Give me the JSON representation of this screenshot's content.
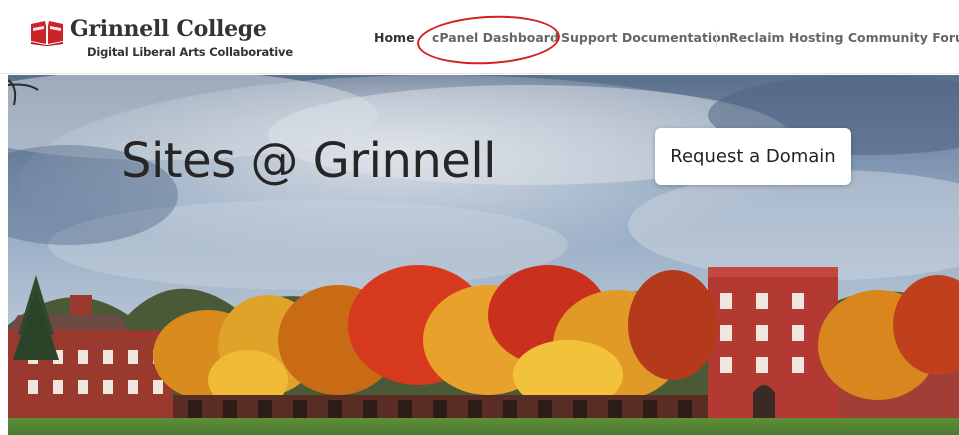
{
  "brand": {
    "title": "Grinnell College",
    "subtitle": "Digital Liberal Arts Collaborative",
    "logo_color": "#cc2229"
  },
  "nav": {
    "items": [
      {
        "label": "Home",
        "active": true
      },
      {
        "label": "cPanel Dashboard",
        "active": false
      },
      {
        "label": "Support Documentation",
        "active": false
      },
      {
        "label": "Reclaim Hosting Community Forums",
        "active": false
      }
    ],
    "highlight_color": "#d41f1f"
  },
  "hero": {
    "title": "Sites @ Grinnell",
    "cta_label": "Request a Domain"
  }
}
